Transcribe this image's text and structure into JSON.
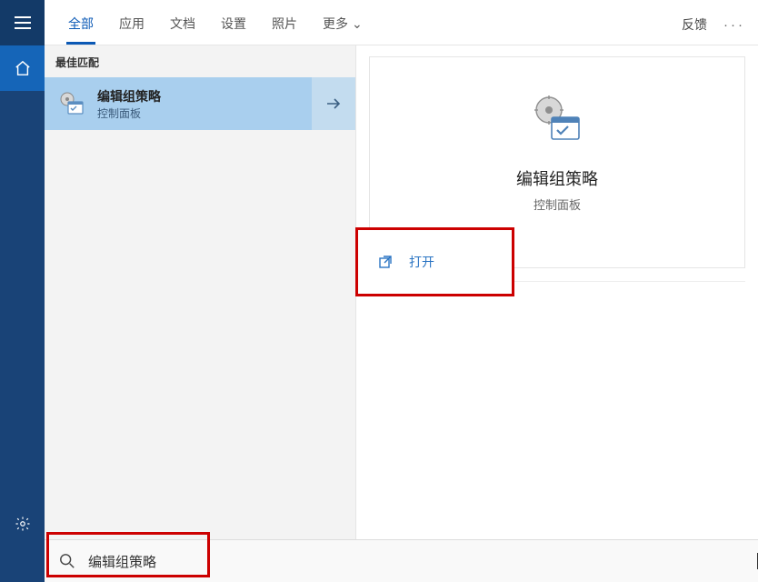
{
  "tabs": {
    "all": "全部",
    "apps": "应用",
    "docs": "文档",
    "settings": "设置",
    "photos": "照片",
    "more": "更多"
  },
  "header": {
    "feedback": "反馈"
  },
  "results": {
    "section": "最佳匹配",
    "item": {
      "title": "编辑组策略",
      "subtitle": "控制面板"
    }
  },
  "detail": {
    "title": "编辑组策略",
    "subtitle": "控制面板",
    "open": "打开"
  },
  "search": {
    "value": "编辑组策略"
  }
}
